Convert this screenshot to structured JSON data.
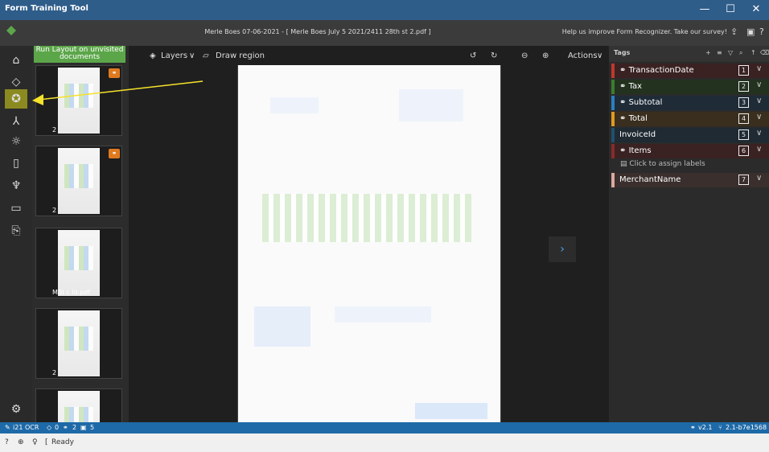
{
  "window": {
    "title": "Form Training Tool",
    "minimize": "—",
    "maximize": "☐",
    "close": "✕"
  },
  "header": {
    "document_title": "Merle Boes 07-06-2021 - [ Merle Boes July 5 2021/2411 28th st 2.pdf ]",
    "survey_text": "Help us improve Form Recognizer. Take our survey!"
  },
  "thumbnails": {
    "run_layout_label": "Run Layout on unvisited documents",
    "items": [
      {
        "caption": "2"
      },
      {
        "caption": "2"
      },
      {
        "caption": "MBI c                    ld.pdf"
      },
      {
        "caption": "2"
      },
      {
        "caption": ""
      }
    ]
  },
  "canvas_toolbar": {
    "layers_label": "Layers",
    "draw_region_label": "Draw region",
    "actions_label": "Actions"
  },
  "tags_panel": {
    "title": "Tags",
    "click_to_assign": "Click to assign labels",
    "items": [
      {
        "label": "TransactionDate",
        "key": "1",
        "color": "#c0392b",
        "bg": "#3a2222"
      },
      {
        "label": "Tax",
        "key": "2",
        "color": "#3b7d2f",
        "bg": "#23321f"
      },
      {
        "label": "Subtotal",
        "key": "3",
        "color": "#2a7fbf",
        "bg": "#1f2c38"
      },
      {
        "label": "Total",
        "key": "4",
        "color": "#e09a1f",
        "bg": "#3a2f1f"
      },
      {
        "label": "InvoiceId",
        "key": "5",
        "color": "#1f4f6f",
        "bg": "#1f2a33"
      },
      {
        "label": "Items",
        "key": "6",
        "color": "#8b2a2a",
        "bg": "#3a2222"
      },
      {
        "label": "MerchantName",
        "key": "7",
        "color": "#d9a9a0",
        "bg": "#3a2f2d"
      }
    ]
  },
  "status_bar": {
    "ocr": "i21 OCR",
    "tags_count": "0",
    "labeled_count": "2",
    "docs_count": "5",
    "version": "v2.1",
    "build": "2.1-b7e1568"
  },
  "bottom_bar": {
    "status": "Ready"
  },
  "colors": {
    "accent": "#5ca64a",
    "status_bar": "#1e6aa8",
    "active_nav": "#8b8a20"
  }
}
